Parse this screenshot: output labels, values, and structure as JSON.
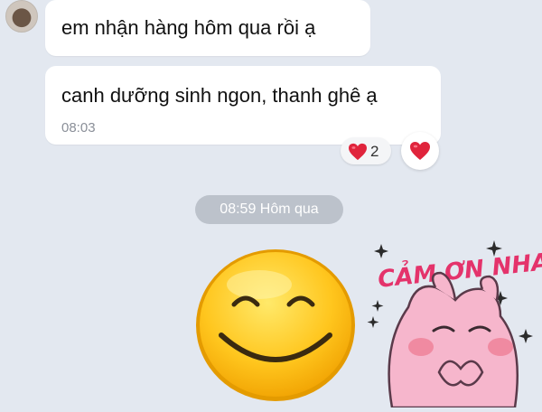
{
  "messages": [
    {
      "text": "em nhận hàng hôm qua rồi ạ"
    },
    {
      "text": "canh dưỡng sinh ngon, thanh ghê ạ",
      "time": "08:03"
    }
  ],
  "reactions": {
    "count": "2",
    "icon": "heart-icon",
    "color": "#e0243c"
  },
  "date_separator": "08:59 Hôm qua",
  "sticker": {
    "text": "CẢM ƠN NHA!"
  },
  "colors": {
    "background": "#e3e8f0",
    "bubble": "#ffffff",
    "date_pill": "#bcc2cb",
    "heart": "#e0243c"
  }
}
